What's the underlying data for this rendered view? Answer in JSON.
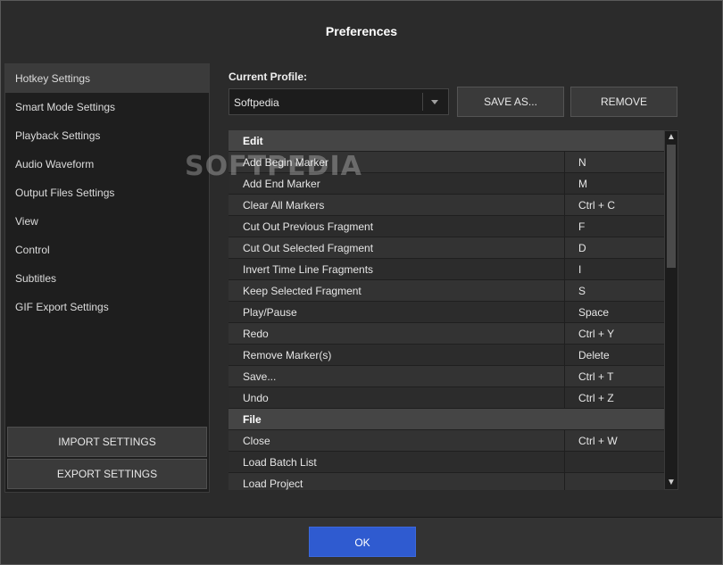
{
  "window": {
    "title": "Preferences"
  },
  "sidebar": {
    "items": [
      {
        "label": "Hotkey Settings",
        "active": true
      },
      {
        "label": "Smart Mode Settings"
      },
      {
        "label": "Playback Settings"
      },
      {
        "label": "Audio Waveform"
      },
      {
        "label": "Output Files Settings"
      },
      {
        "label": "View"
      },
      {
        "label": "Control"
      },
      {
        "label": "Subtitles"
      },
      {
        "label": "GIF Export Settings"
      }
    ],
    "import_label": "IMPORT SETTINGS",
    "export_label": "EXPORT SETTINGS"
  },
  "profile": {
    "label": "Current Profile:",
    "value": "Softpedia",
    "save_as_label": "SAVE AS...",
    "remove_label": "REMOVE"
  },
  "hotkeys": {
    "rows": [
      {
        "type": "header",
        "action": "Edit",
        "key": ""
      },
      {
        "type": "item",
        "action": "Add Begin Marker",
        "key": "N"
      },
      {
        "type": "item",
        "action": "Add End Marker",
        "key": "M"
      },
      {
        "type": "item",
        "action": "Clear All Markers",
        "key": "Ctrl + C"
      },
      {
        "type": "item",
        "action": "Cut Out Previous Fragment",
        "key": "F"
      },
      {
        "type": "item",
        "action": "Cut Out Selected Fragment",
        "key": "D"
      },
      {
        "type": "item",
        "action": "Invert Time Line Fragments",
        "key": "I"
      },
      {
        "type": "item",
        "action": "Keep Selected Fragment",
        "key": "S"
      },
      {
        "type": "item",
        "action": "Play/Pause",
        "key": "Space"
      },
      {
        "type": "item",
        "action": "Redo",
        "key": "Ctrl + Y"
      },
      {
        "type": "item",
        "action": "Remove Marker(s)",
        "key": "Delete"
      },
      {
        "type": "item",
        "action": "Save...",
        "key": "Ctrl + T"
      },
      {
        "type": "item",
        "action": "Undo",
        "key": "Ctrl + Z"
      },
      {
        "type": "header",
        "action": "File",
        "key": ""
      },
      {
        "type": "item",
        "action": "Close",
        "key": "Ctrl + W"
      },
      {
        "type": "item",
        "action": "Load Batch List",
        "key": ""
      },
      {
        "type": "item",
        "action": "Load Project",
        "key": ""
      }
    ]
  },
  "watermark": "SOFTPEDIA",
  "footer": {
    "ok_label": "OK"
  },
  "colors": {
    "accent": "#2f5bd0",
    "background": "#2b2b2b",
    "header_row": "#454545"
  },
  "icons": {
    "dropdown": "chevron-down-icon",
    "scroll_up": "chevron-up-icon",
    "scroll_down": "chevron-down-icon"
  }
}
